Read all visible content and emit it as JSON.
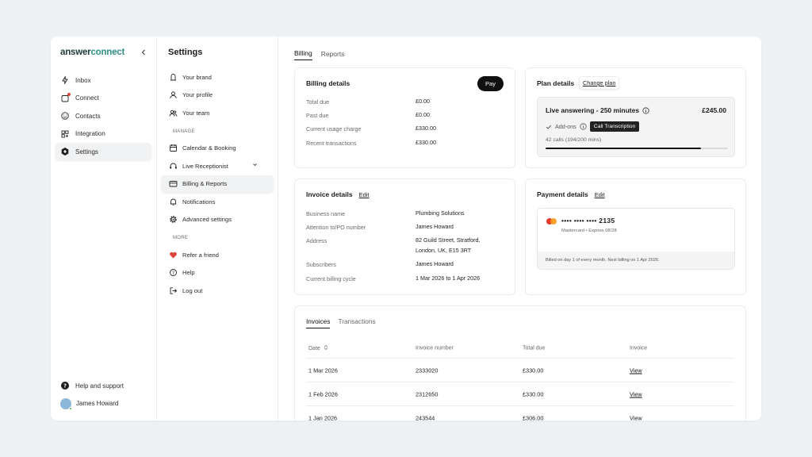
{
  "nav": {
    "logo": {
      "main": "answer",
      "highlight": "connect"
    },
    "items": [
      {
        "label": "Inbox",
        "icon": "inbox-icon"
      },
      {
        "label": "Connect",
        "icon": "connect-icon"
      },
      {
        "label": "Contacts",
        "icon": "contacts-icon"
      },
      {
        "label": "Integration",
        "icon": "integration-icon"
      },
      {
        "label": "Settings",
        "icon": "gear-icon",
        "active": true
      }
    ],
    "help": "Help and support",
    "user": "James Howard"
  },
  "settings": {
    "title": "Settings",
    "top_items": [
      "Your brand",
      "Your profile",
      "Your team"
    ],
    "manage_heading": "MANAGE",
    "manage_items": [
      "Calendar & Booking",
      "Live Receptionist",
      "Billing & Reports",
      "Notifications",
      "Advanced settings"
    ],
    "more_heading": "MORE",
    "more_items": [
      "Refer a friend",
      "Help",
      "Log out"
    ]
  },
  "tabs": [
    "Billing",
    "Reports"
  ],
  "billing": {
    "title": "Billing details",
    "pay_label": "Pay",
    "rows": [
      {
        "label": "Total due",
        "value": "£0.00"
      },
      {
        "label": "Past due",
        "value": "£0.00"
      },
      {
        "label": "Current usage charge",
        "value": "£330.00"
      },
      {
        "label": "Recent transactions",
        "value": "£330.00"
      }
    ]
  },
  "plan": {
    "title": "Plan details",
    "change_label": "Change plan",
    "name": "Live answering - 250 minutes",
    "price": "£245.00",
    "addons_label": "Add-ons",
    "tooltip": "Call Transcription",
    "calls": "42 calls (194/200 mins)",
    "usage_fraction": 0.85
  },
  "invoice_details": {
    "title": "Invoice details",
    "edit_label": "Edit",
    "rows": [
      {
        "label": "Business name",
        "value": "Plumbing Solutions"
      },
      {
        "label": "Attention to/PO number",
        "value": "James Howard"
      },
      {
        "label": "Address",
        "value": "82 Guild Street, Stratford,",
        "value2": "London, UK, E15 3RT"
      },
      {
        "label": "Subscribers",
        "value": "James Howard"
      },
      {
        "label": "Current billing cycle",
        "value": "1 Mar 2026 to 1 Apr 2026"
      }
    ]
  },
  "payment": {
    "title": "Payment details",
    "edit_label": "Edit",
    "card_number": "•••• •••• •••• 2135",
    "card_meta": "Mastercard • Expires 08/28",
    "footer": "Billed on day 1 of every month. Next billing on 1 Apr 2026.",
    "colors": {
      "mc_red": "#eb3b2e",
      "mc_orange": "#f59b1b"
    }
  },
  "invoices": {
    "tabs": [
      "Invoices",
      "Transactions"
    ],
    "columns": [
      "Date",
      "Invoice number",
      "Total due",
      "Invoice"
    ],
    "rows": [
      {
        "date": "1 Mar 2026",
        "number": "2333020",
        "total": "£330.00",
        "action": "View"
      },
      {
        "date": "1 Feb 2026",
        "number": "2312650",
        "total": "£330.00",
        "action": "View"
      },
      {
        "date": "1 Jan 2026",
        "number": "243544",
        "total": "£306.00",
        "action": "View"
      }
    ]
  }
}
